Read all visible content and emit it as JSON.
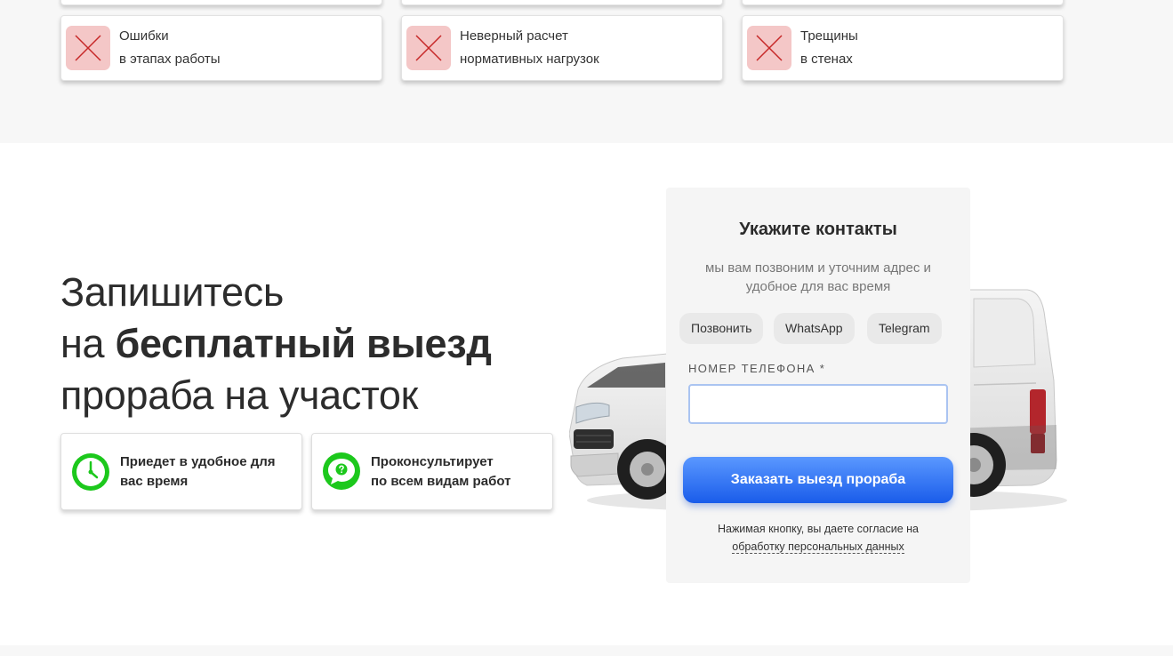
{
  "problems": [
    {
      "line1": "Ошибки",
      "line2": "в этапах работы",
      "icon": "x-icon"
    },
    {
      "line1": "Неверный расчет",
      "line2": "нормативных нагрузок",
      "icon": "x-icon"
    },
    {
      "line1": "Трещины",
      "line2": "в стенах",
      "icon": "x-icon"
    }
  ],
  "headline": {
    "line1": "Запишитесь",
    "line2_prefix": "на ",
    "line2_bold": "бесплатный выезд",
    "line3": "прораба на участок"
  },
  "features": [
    {
      "line1": "Приедет в удобное для",
      "line2": "вас время",
      "icon": "clock-icon"
    },
    {
      "line1": "Проконсультирует",
      "line2": "по всем видам работ",
      "icon": "question-bubble-icon"
    }
  ],
  "form": {
    "title": "Укажите контакты",
    "subtitle_line1": "мы вам позвоним и уточним адрес и",
    "subtitle_line2": "удобное для вас время",
    "methods": [
      "Позвонить",
      "WhatsApp",
      "Telegram"
    ],
    "phone_label": "НОМЕР ТЕЛЕФОНА *",
    "phone_value": "",
    "submit_label": "Заказать выезд прораба",
    "consent_text": "Нажимая кнопку, вы даете согласие на",
    "consent_link": "обработку персональных данных"
  },
  "colors": {
    "accent": "#2b6ef5",
    "feature_icon": "#1cc81c",
    "x_icon": "#c62828",
    "x_bg": "#f4c7c7"
  }
}
